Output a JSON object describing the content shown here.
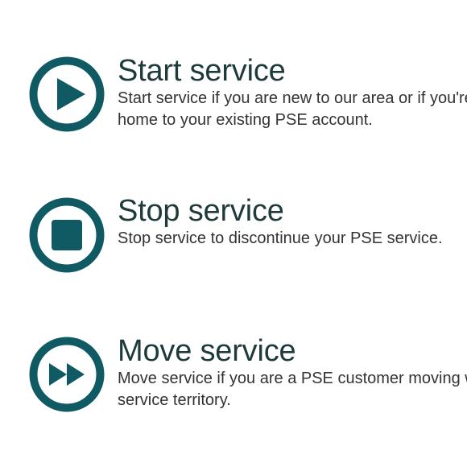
{
  "colors": {
    "icon": "#0f5a63",
    "title": "#1f3a3b",
    "description": "#333333"
  },
  "services": [
    {
      "icon": "play-icon",
      "title": "Start service",
      "description": "Start service if you are new to our area or if you're moving home to your existing PSE account."
    },
    {
      "icon": "stop-icon",
      "title": "Stop service",
      "description": "Stop service to discontinue your PSE service."
    },
    {
      "icon": "fast-forward-icon",
      "title": "Move service",
      "description": "Move service if you are a PSE customer moving within our service territory."
    }
  ]
}
